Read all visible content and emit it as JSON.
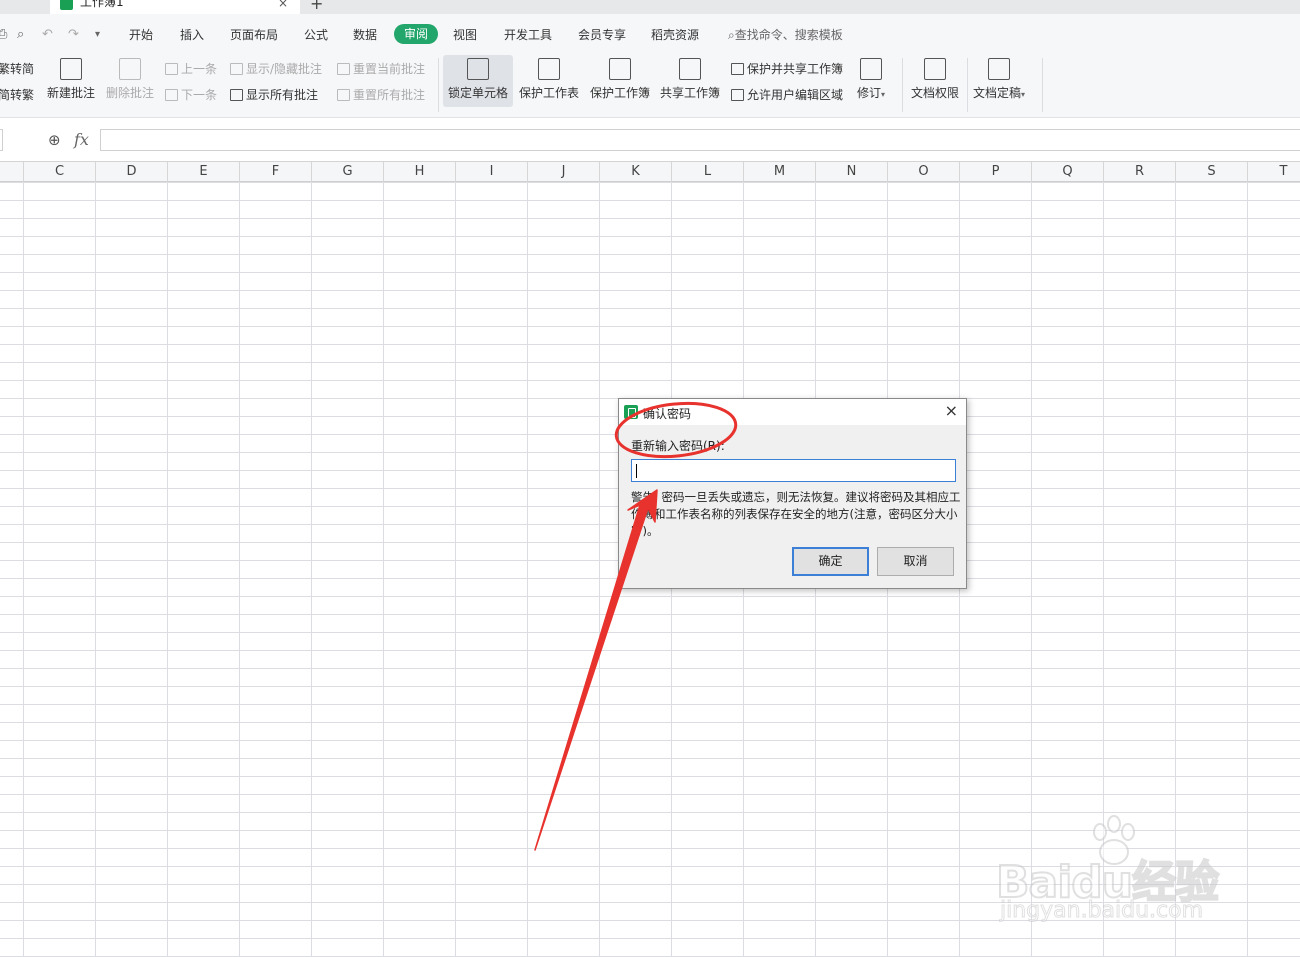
{
  "tab": {
    "file_name": "工作簿1",
    "close": "×",
    "new_tab": "+"
  },
  "menu": {
    "items": [
      "开始",
      "插入",
      "页面布局",
      "公式",
      "数据",
      "审阅",
      "视图",
      "开发工具",
      "会员专享",
      "稻壳资源"
    ],
    "active": "审阅",
    "search_placeholder": "查找命令、搜索模板"
  },
  "ribbon": {
    "left_partial": [
      "繁转简",
      "简转繁"
    ],
    "new_comment": "新建批注",
    "delete_comment": "删除批注",
    "prev": "上一条",
    "next": "下一条",
    "show_hide_comment": "显示/隐藏批注",
    "show_all_comments": "显示所有批注",
    "reset_current_comment": "重置当前批注",
    "reset_all_comments": "重置所有批注",
    "lock_cell": "锁定单元格",
    "protect_sheet": "保护工作表",
    "protect_workbook": "保护工作簿",
    "share_workbook": "共享工作簿",
    "protect_and_share": "保护并共享工作簿",
    "allow_edit_ranges": "允许用户编辑区域",
    "track_changes": "修订",
    "doc_permissions": "文档权限",
    "doc_finalize": "文档定稿"
  },
  "formula_bar": {
    "fx": "fx",
    "value": ""
  },
  "columns": [
    "C",
    "D",
    "E",
    "F",
    "G",
    "H",
    "I",
    "J",
    "K",
    "L",
    "M",
    "N",
    "O",
    "P",
    "Q",
    "R",
    "S",
    "T"
  ],
  "dialog": {
    "title": "确认密码",
    "close": "×",
    "label": "重新输入密码(R):",
    "value": "",
    "warning": "警告: 密码一旦丢失或遗忘，则无法恢复。建议将密码及其相应工作簿和工作表名称的列表保存在安全的地方(注意，密码区分大小写)。",
    "ok": "确定",
    "cancel": "取消"
  },
  "annotation": {
    "color": "#e8322d"
  },
  "watermark": {
    "logo": "Baidu经验",
    "url": "jingyan.baidu.com"
  }
}
